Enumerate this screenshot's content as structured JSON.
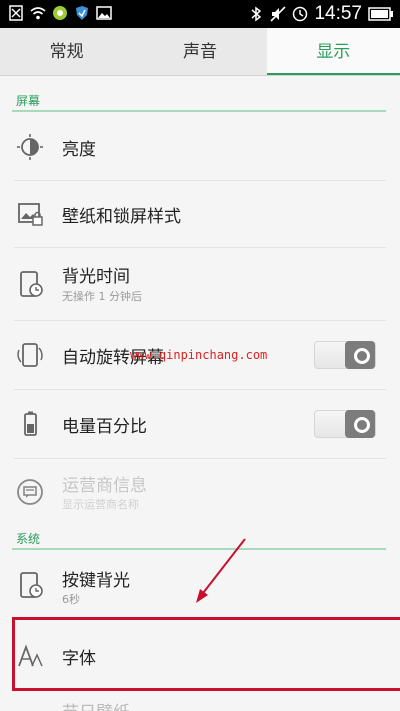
{
  "status_bar": {
    "time": "14:57"
  },
  "tabs": [
    {
      "label": "常规",
      "active": false
    },
    {
      "label": "声音",
      "active": false
    },
    {
      "label": "显示",
      "active": true
    }
  ],
  "sections": {
    "screen": "屏幕",
    "system": "系统"
  },
  "rows": {
    "brightness": {
      "title": "亮度"
    },
    "wallpaper": {
      "title": "壁纸和锁屏样式"
    },
    "backlight": {
      "title": "背光时间",
      "sub": "无操作 1 分钟后"
    },
    "auto_rotate": {
      "title": "自动旋转屏幕"
    },
    "battery_percent": {
      "title": "电量百分比"
    },
    "carrier_info": {
      "title": "运营商信息",
      "sub": "显示运营商名称"
    },
    "key_backlight": {
      "title": "按键背光",
      "sub": "6秒"
    },
    "font": {
      "title": "字体"
    },
    "partial": {
      "title": "节日壁纸"
    }
  },
  "watermark": "www.qinpinchang.com",
  "colors": {
    "accent": "#2a9d5c",
    "highlight": "#c8102e"
  }
}
